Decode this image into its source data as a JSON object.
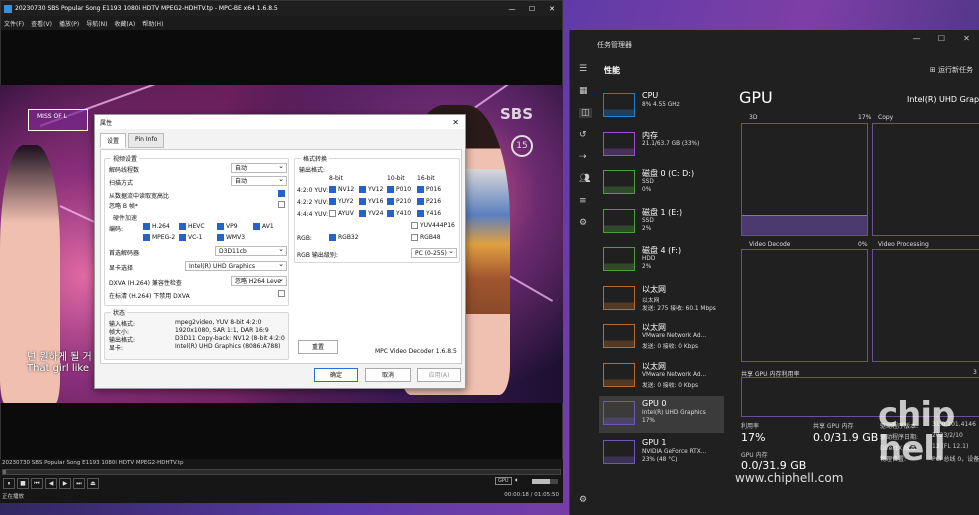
{
  "mpc": {
    "title": "20230730 SBS Popular Song E1193 1080i HDTV MPEG2-HDHTV.tp - MPC-BE x64 1.6.8.5",
    "menu": [
      "文件(F)",
      "查看(V)",
      "播放(P)",
      "导航(N)",
      "收藏(A)",
      "帮助(H)"
    ],
    "video": {
      "sbs": "SBS",
      "badge": "15",
      "corner": "MISS OF L",
      "sub1": "넌 원하게 될 거",
      "sub2": "That girl like"
    },
    "file": "20230730 SBS Popular Song E1193 1080i HDTV MPEG2-HDHTV.tp",
    "status": "正在播放",
    "time": "00:00:18 / 01:05:50",
    "progress": 0.005,
    "buttons": [
      "⏸",
      "■",
      "⏮",
      "◀",
      "▶",
      "⏭",
      "⏏"
    ],
    "vol_label": "GPU"
  },
  "dialog": {
    "title": "属性",
    "tabs": [
      "设置",
      "Pin Info"
    ],
    "video_settings": "视频设置",
    "decode_threads": "解码线程数",
    "decode_threads_val": "自动",
    "scan": "扫描方式",
    "scan_val": "自动",
    "read_aspect": "从数据流中读取宽高比",
    "ignore": "忽略 B 帧*",
    "hw_accel": "硬件加速",
    "codec_label": "编码:",
    "codecs": [
      "H.264",
      "HEVC",
      "VP9",
      "AV1",
      "MPEG-2",
      "VC-1",
      "WMV3"
    ],
    "pref_decoder": "首选解码器",
    "pref_decoder_val": "D3D11cb",
    "display": "显卡选择",
    "display_val": "Intel(R) UHD Graphics",
    "dxva_check": "DXVA (H.264) 兼容性检查",
    "dxva_check_val": "忽略 H264 Leve",
    "disable_dxva": "在标清 (H.264) 下禁用 DXVA",
    "status": "状态",
    "st_labels": [
      "输入格式:",
      "帧大小:",
      "输出格式:",
      "显卡:"
    ],
    "st_vals": [
      "mpeg2video, YUV 8-bit 4:2:0",
      "1920x1080, SAR 1:1, DAR 16:9",
      "D3D11 Copy-back: NV12 (8-bit 4:2:0",
      "Intel(R) UHD Graphics (8086:A788)"
    ],
    "format_conv": "格式转换",
    "out_formats": "输出格式:",
    "bits": [
      "8-bit",
      "10-bit",
      "16-bit"
    ],
    "fmt_rows": [
      {
        "label": "4:2:0 YUV:",
        "items": [
          "NV12",
          "YV12",
          "P010",
          "P016"
        ]
      },
      {
        "label": "4:2:2 YUV:",
        "items": [
          "YUY2",
          "YV16",
          "P210",
          "P216"
        ]
      },
      {
        "label": "4:4:4 YUV:",
        "items": [
          "AYUV",
          "YV24",
          "Y410",
          "Y416"
        ]
      }
    ],
    "yuv444p16": "YUV444P16",
    "rgb": "RGB:",
    "rgb32": "RGB32",
    "rgb48": "RGB48",
    "rgb_level": "RGB 输出级别:",
    "rgb_level_val": "PC (0-255)",
    "reset": "重置",
    "version": "MPC Video Decoder 1.6.8.5",
    "ok": "确定",
    "cancel": "取消",
    "apply": "应用(A)"
  },
  "taskmgr": {
    "title": "任务管理器",
    "perf": "性能",
    "run": "运行新任务",
    "items": [
      {
        "n": "CPU",
        "s1": "8% 4.55 GHz",
        "s2": "",
        "color": "#1f7fd0"
      },
      {
        "n": "内存",
        "s1": "21.1/63.7 GB (33%)",
        "s2": "",
        "color": "#9a4fd1"
      },
      {
        "n": "磁盘 0 (C: D:)",
        "s1": "SSD",
        "s2": "0%",
        "color": "#4c9f3c"
      },
      {
        "n": "磁盘 1 (E:)",
        "s1": "SSD",
        "s2": "2%",
        "color": "#4c9f3c"
      },
      {
        "n": "磁盘 4 (F:)",
        "s1": "HDD",
        "s2": "2%",
        "color": "#4c9f3c"
      },
      {
        "n": "以太网",
        "s1": "以太网",
        "s2": "发送: 275 接收: 60.1 Mbps",
        "color": "#b86b2a"
      },
      {
        "n": "以太网",
        "s1": "VMware Network Ad...",
        "s2": "发送: 0 接收: 0 Kbps",
        "color": "#b86b2a"
      },
      {
        "n": "以太网",
        "s1": "VMware Network Ad...",
        "s2": "发送: 0 接收: 0 Kbps",
        "color": "#b86b2a"
      },
      {
        "n": "GPU 0",
        "s1": "Intel(R) UHD Graphics",
        "s2": "17%",
        "color": "#6f56b8"
      },
      {
        "n": "GPU 1",
        "s1": "NVIDIA GeForce RTX...",
        "s2": "23% (48 °C)",
        "color": "#6f56b8"
      }
    ],
    "gpu": "GPU",
    "gpu_name": "Intel(R) UHD Graph",
    "g3d": "3D",
    "g3d_pct": "17%",
    "gcopy": "Copy",
    "gvd": "Video Decode",
    "gvd_pct": "0%",
    "gvp": "Video Processing",
    "shared": "共享 GPU 内存利用率",
    "shared_r": "3",
    "util_k": "利用率",
    "util_v": "17%",
    "sh_k": "共享 GPU 内存",
    "sh_v": "0.0/31.9 GB",
    "gm_k": "GPU 内存",
    "gm_v": "0.0/31.9 GB",
    "drv": [
      "驱动程序版本:",
      "驱动程序日期:",
      "DirectX 版本:",
      "物理位置:"
    ],
    "drv_v": [
      "31.0.101.4146",
      "2023/2/10",
      "12 (FL 12.1)",
      "PCI 总线 0，设备"
    ]
  },
  "watermark": "www.chiphell.com",
  "wm_logo": "chip hell"
}
